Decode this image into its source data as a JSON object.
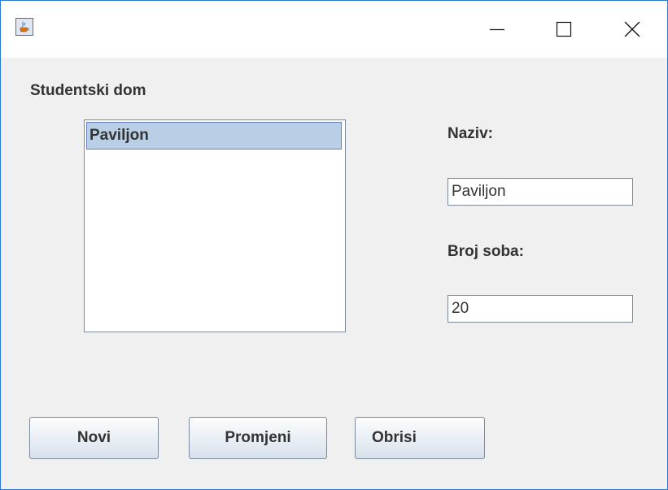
{
  "window": {
    "title": "",
    "icon": "java-cup-icon",
    "controls": {
      "minimize_icon": "minimize-icon",
      "maximize_icon": "maximize-icon",
      "close_icon": "close-icon"
    }
  },
  "form": {
    "list_label": "Studentski dom",
    "list_items": [
      "Paviljon"
    ],
    "selected_index": 0,
    "naziv_label": "Naziv:",
    "naziv_value": "Paviljon",
    "broj_soba_label": "Broj soba:",
    "broj_soba_value": "20"
  },
  "buttons": {
    "novi": "Novi",
    "promjeni": "Promjeni",
    "obrisi": "Obrisi"
  },
  "colors": {
    "window_border": "#2b79d6",
    "selection_bg": "#b8cfe5",
    "selection_border": "#6382bf",
    "panel_bg": "#f0f0f0"
  }
}
